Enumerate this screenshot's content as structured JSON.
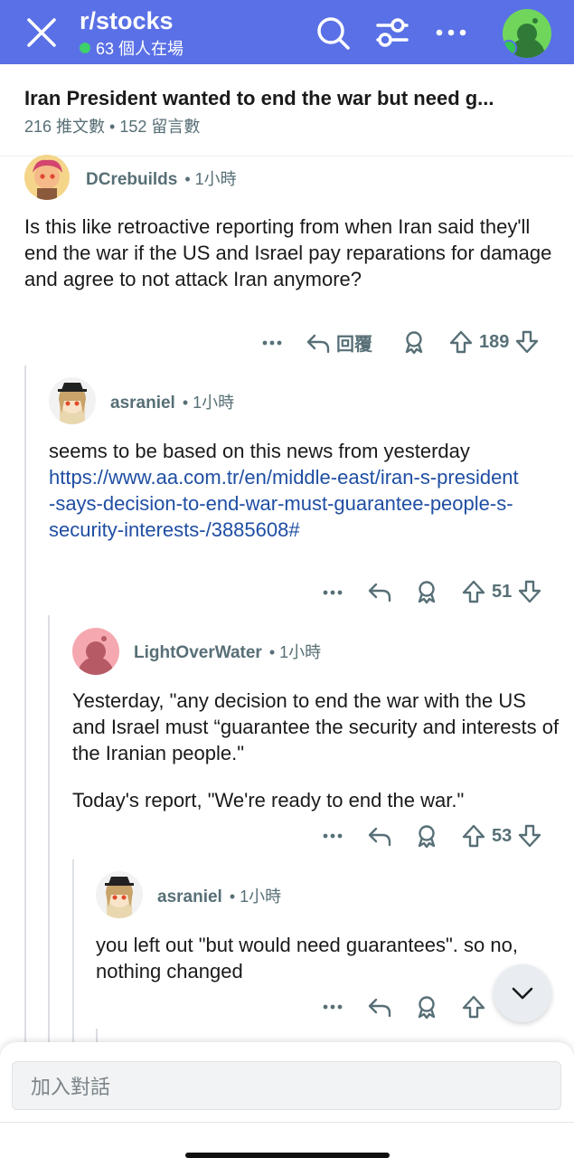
{
  "header": {
    "subreddit": "r/stocks",
    "online": "63 個人在場"
  },
  "post": {
    "title": "Iran President wanted to end the war but need g...",
    "meta": "216 推文數 • 152 留言數"
  },
  "comments": [
    {
      "user": "DCrebuilds",
      "time": "• 1小時",
      "body": "Is this like retroactive reporting from when Iran said they'll end the war if the US and Israel pay reparations for damage and agree to not attack Iran anymore?",
      "reply_label": "回覆",
      "votes": "189"
    },
    {
      "user": "asraniel",
      "time": "• 1小時",
      "body": "seems to be based on this news from yesterday",
      "link": "https://www.aa.com.tr/en/middle-east/iran-s-president-says-decision-to-end-war-must-guarantee-people-s-security-interests-/3885608#",
      "votes": "51"
    },
    {
      "user": "LightOverWater",
      "time": "• 1小時",
      "body": "Yesterday, \"any decision to end the war with the US and Israel must “guarantee the security and interests of the Iranian people.\"",
      "body2": "Today's report, \"We're ready to end the war.\"",
      "votes": "53"
    },
    {
      "user": "asraniel",
      "time": "• 1小時",
      "body": "you left out \"but would need guarantees\". so no, nothing changed",
      "votes": ""
    }
  ],
  "composer": {
    "placeholder": "加入對話"
  },
  "colors": {
    "header_bg": "#5a70e6",
    "online": "#3ed06a",
    "link": "#1f4ea3"
  }
}
